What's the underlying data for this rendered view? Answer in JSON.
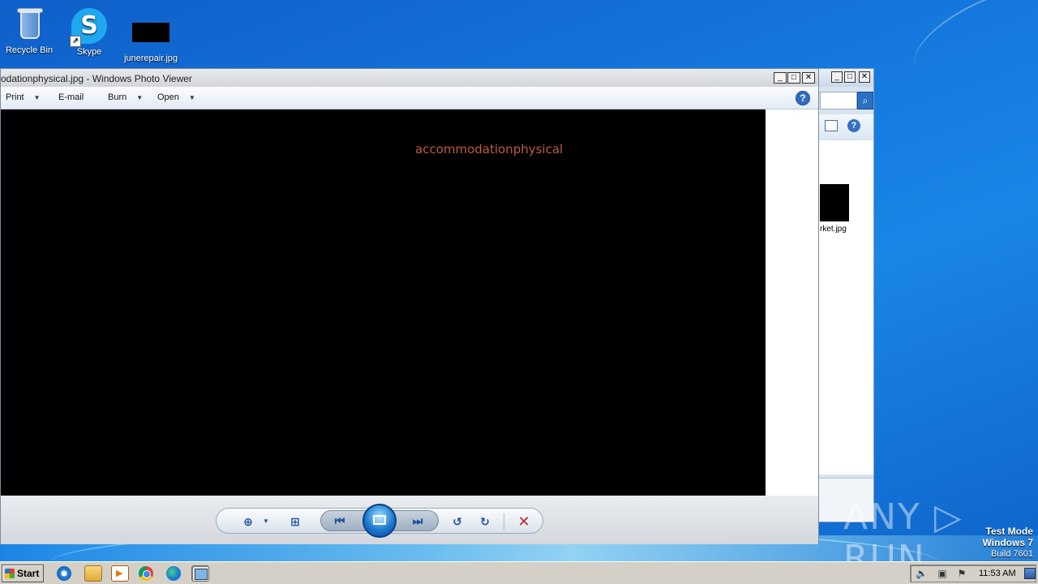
{
  "desktop": {
    "icons": [
      {
        "label": "Recycle Bin",
        "icon": "recycle-bin-icon"
      },
      {
        "label": "Skype",
        "icon": "skype-icon",
        "glyph": "S"
      },
      {
        "label": "junerepair.jpg",
        "icon": "image-file-icon"
      }
    ]
  },
  "explorer": {
    "file_label": "rket.jpg",
    "search_glyph": "⌕",
    "help_glyph": "?"
  },
  "viewer": {
    "title": "odationphysical.jpg - Windows Photo Viewer",
    "menu": {
      "print": "Print",
      "email": "E-mail",
      "burn": "Burn",
      "open": "Open"
    },
    "help_glyph": "?",
    "image_text": "accommodationphysical",
    "colors": {
      "image_text": "#c05a3a",
      "image_bg": "#000000"
    }
  },
  "watermark": {
    "text": "ANY ▷ RUN",
    "test_mode": "Test Mode",
    "os": "Windows 7",
    "build": "Build 7601"
  },
  "taskbar": {
    "start_label": "Start",
    "clock": "11:53 AM"
  }
}
